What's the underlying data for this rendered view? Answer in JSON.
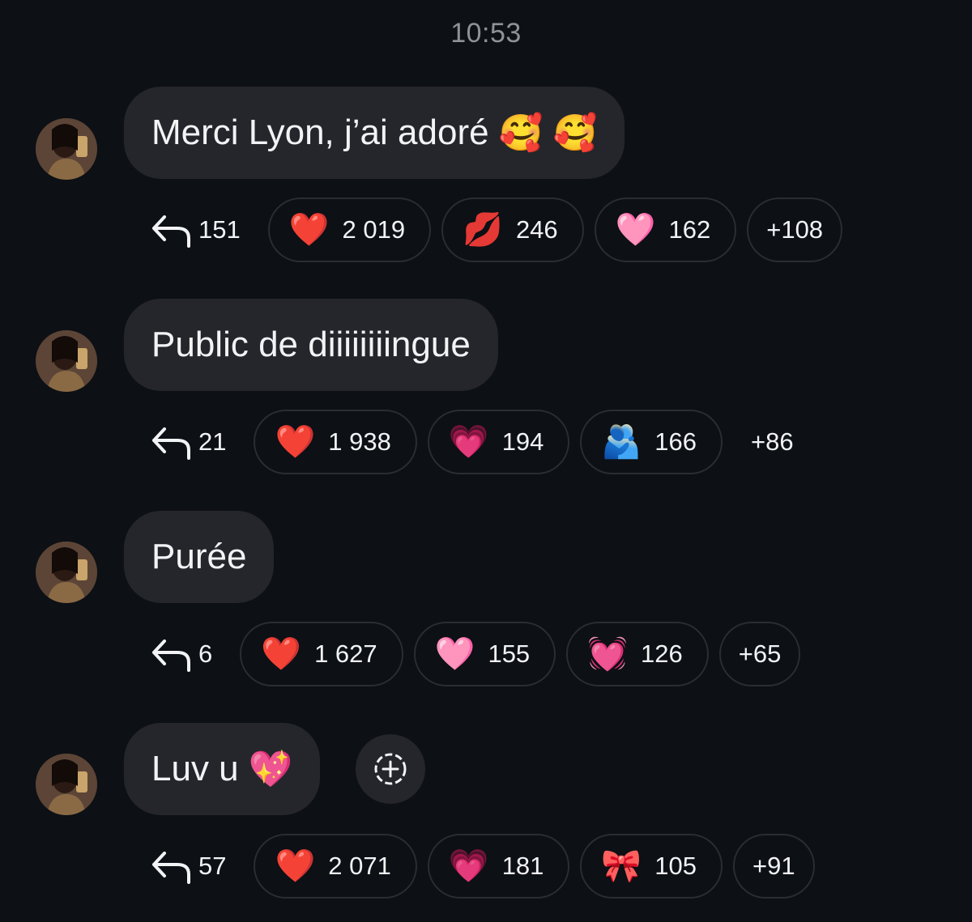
{
  "header": {
    "time": "10:53"
  },
  "messages": [
    {
      "text": "Merci Lyon, j’ai adoré",
      "emoji": "🥰 🥰",
      "reply_count": "151",
      "reactions": [
        {
          "emoji": "❤️",
          "count": "2 019"
        },
        {
          "emoji": "💋",
          "count": "246"
        },
        {
          "emoji": "🩷",
          "count": "162"
        }
      ],
      "more": "+108"
    },
    {
      "text": "Public de diiiiiiiingue",
      "emoji": "",
      "reply_count": "21",
      "reactions": [
        {
          "emoji": "❤️",
          "count": "1 938"
        },
        {
          "emoji": "💗",
          "count": "194"
        },
        {
          "emoji": "🫂",
          "count": "166"
        }
      ],
      "more": "+86"
    },
    {
      "text": "Purée",
      "emoji": "",
      "reply_count": "6",
      "reactions": [
        {
          "emoji": "❤️",
          "count": "1 627"
        },
        {
          "emoji": "🩷",
          "count": "155"
        },
        {
          "emoji": "💓",
          "count": "126"
        }
      ],
      "more": "+65"
    },
    {
      "text": "Luv u",
      "emoji": "💖",
      "reply_count": "57",
      "reactions": [
        {
          "emoji": "❤️",
          "count": "2 071"
        },
        {
          "emoji": "💗",
          "count": "181"
        },
        {
          "emoji": "🎀",
          "count": "105"
        }
      ],
      "more": "+91"
    }
  ],
  "icons": {
    "reply": "reply-arrow-icon",
    "add_reaction": "add-reaction-icon"
  },
  "colors": {
    "background": "#0d1015",
    "bubble": "#24262b",
    "chip_border": "#2a2d33",
    "timestamp": "#8e9299"
  }
}
